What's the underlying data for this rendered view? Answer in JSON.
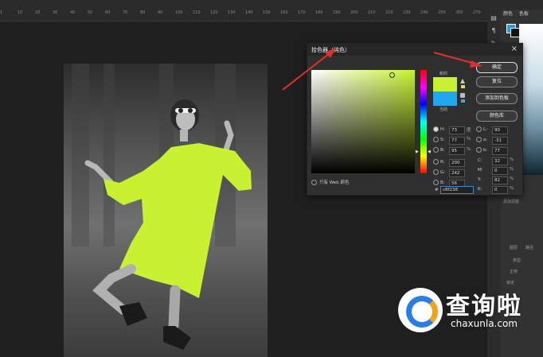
{
  "ruler": {
    "ticks": [
      "1",
      "10",
      "20",
      "30",
      "40",
      "50",
      "60",
      "70",
      "80",
      "90",
      "100",
      "110",
      "120",
      "130",
      "140",
      "150",
      "160",
      "170",
      "180",
      "190",
      "200",
      "210",
      "220",
      "230",
      "240",
      "250",
      "260",
      "270"
    ]
  },
  "right_panel": {
    "tabs": [
      "颜色",
      "色板"
    ],
    "section_adjust": "添加调整",
    "section_layers": [
      "图层",
      "路径"
    ],
    "kind_label": "类型",
    "mode_label": "正常",
    "lock_label": "锁定"
  },
  "dialog": {
    "title": "拾色器（纯色）",
    "new_label": "新的",
    "current_label": "当前",
    "buttons": {
      "ok": "确定",
      "reset": "复位",
      "add_to_swatches": "添加到色板",
      "color_libraries": "颜色库"
    },
    "fields": {
      "H": {
        "value": "73",
        "unit": "度"
      },
      "S": {
        "value": "77",
        "unit": "%"
      },
      "B": {
        "value": "95",
        "unit": "%"
      },
      "R": {
        "value": "200",
        "unit": ""
      },
      "G": {
        "value": "242",
        "unit": ""
      },
      "Bb": {
        "value": "56",
        "unit": ""
      },
      "L": {
        "value": "90",
        "unit": ""
      },
      "a": {
        "value": "-31",
        "unit": ""
      },
      "b": {
        "value": "77",
        "unit": ""
      },
      "C": {
        "value": "32",
        "unit": "%"
      },
      "M": {
        "value": "0",
        "unit": "%"
      },
      "Y": {
        "value": "82",
        "unit": "%"
      },
      "K": {
        "value": "0",
        "unit": "%"
      },
      "hex": "c8f238"
    },
    "web_only": "只有 Web 颜色",
    "colors": {
      "new": "#c8f231",
      "current": "#20a7f0"
    }
  },
  "watermark": {
    "name": "查询啦",
    "domain": "chaxunla.com"
  }
}
